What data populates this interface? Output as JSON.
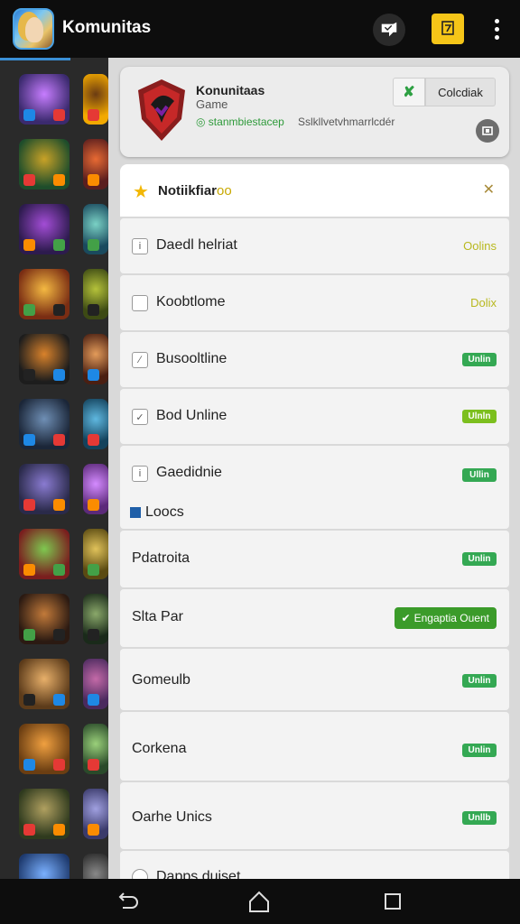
{
  "app": {
    "title": "Komunitas",
    "icon": "app-icon",
    "chat_icon": "chat-bubble-icon",
    "trophy_icon": "trophy-icon",
    "more_icon": "more-vert-icon"
  },
  "header_card": {
    "title": "Konunitaas",
    "subtitle": "Game",
    "tag": "◎ stanmbiestacep",
    "tag2": "Sslkllvetvhmarrlcdér",
    "follow_icon": "✘",
    "follow_label": "Colcdiak",
    "share_icon": "share-icon"
  },
  "notification": {
    "label": "Notiikfiar",
    "label_accent": "oo",
    "close": "✕"
  },
  "rows": [
    {
      "label": "Daedl helriat",
      "check": "i",
      "status_text": "Oolins"
    },
    {
      "label": "Koobtlome",
      "check": "",
      "status_text": "Dolix"
    },
    {
      "label": "Busooltline",
      "check": "∕",
      "pill": "Unlin"
    },
    {
      "label": "Bod Unline",
      "check": "✓",
      "pill": "Ulnln"
    },
    {
      "label": "Gaedidnie",
      "check": "i",
      "pill": "Ullin",
      "sub_label": "Loocs"
    },
    {
      "label": "Pdatroita",
      "pill": "Unlin"
    },
    {
      "label": "Slta Par",
      "cta": "Engaptia Ouent"
    },
    {
      "label": "Gomeulb",
      "pill": "Unlin"
    },
    {
      "label": "Corkena",
      "pill": "Unlin"
    },
    {
      "label": "Oarhe Unics",
      "pill": "Unllb"
    },
    {
      "label": "Dapps duiset"
    }
  ],
  "colors": {
    "topbar": "#0d0d0d",
    "accent_green": "#34a853",
    "accent_yellow": "#f5c518",
    "panel_bg": "#d9d9d9"
  }
}
